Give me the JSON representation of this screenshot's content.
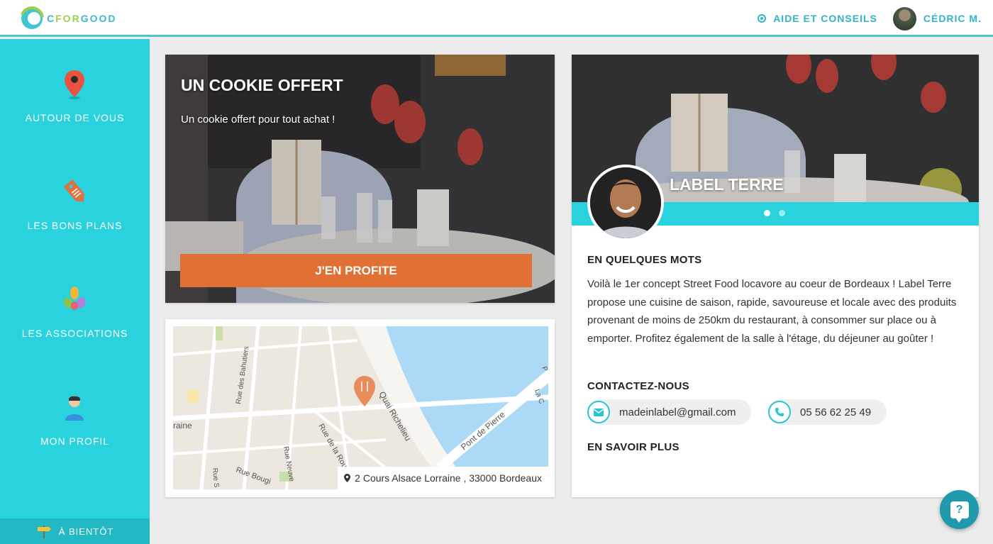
{
  "header": {
    "logo_text_c": "C",
    "logo_text_for": "FOR",
    "logo_text_good": "GOOD",
    "help_label": "AIDE ET CONSEILS",
    "user_name": "CÉDRIC M."
  },
  "sidebar": {
    "items": [
      {
        "label": "AUTOUR DE VOUS",
        "icon": "map-pin-icon"
      },
      {
        "label": "LES BONS PLANS",
        "icon": "price-tag-icon"
      },
      {
        "label": "LES ASSOCIATIONS",
        "icon": "hands-icon"
      },
      {
        "label": "MON PROFIL",
        "icon": "person-icon"
      }
    ],
    "footer_label": "À BIENTÔT"
  },
  "offer": {
    "title": "UN COOKIE OFFERT",
    "subtitle": "Un cookie offert pour tout achat !",
    "cta_label": "J'EN PROFITE"
  },
  "map": {
    "street_labels": [
      "Rue des Bahutiers",
      "Quai Richelieu",
      "Rue de la Rous",
      "Rue Neuve",
      "Pont de Pierre",
      "raine",
      "Rue Bougi",
      "Rue S",
      "La C",
      "P"
    ],
    "address": "2 Cours Alsace Lorraine , 33000 Bordeaux"
  },
  "restaurant": {
    "name": "LABEL TERRE",
    "carousel_count": 2,
    "carousel_active": 1,
    "about_title": "EN QUELQUES MOTS",
    "about_text": "Voilà le 1er concept Street Food locavore au coeur de Bordeaux ! Label Terre propose une cuisine de saison, rapide, savoureuse et locale avec des produits provenant de moins de 250km du restaurant, à consommer sur place ou à emporter. Profitez également de la salle à l'étage, du déjeuner au goûter !",
    "contact_title": "CONTACTEZ-NOUS",
    "email": "madeinlabel@gmail.com",
    "phone": "05 56 62 25 49",
    "more_title": "EN SAVOIR PLUS"
  },
  "colors": {
    "accent": "#29d2dd",
    "cta": "#e07033",
    "brand_text": "#2fb5c6"
  }
}
